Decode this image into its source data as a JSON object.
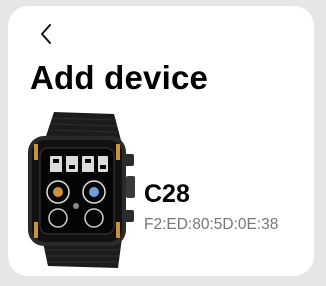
{
  "header": {
    "back_icon": "chevron-left-icon",
    "title": "Add device"
  },
  "device": {
    "image_icon": "smartwatch-icon",
    "name": "C28",
    "mac": "F2:ED:80:5D:0E:38"
  }
}
